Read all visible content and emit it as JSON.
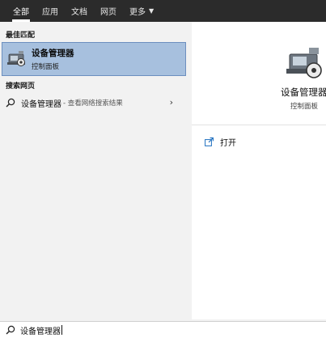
{
  "tabs": [
    {
      "label": "全部"
    },
    {
      "label": "应用"
    },
    {
      "label": "文档"
    },
    {
      "label": "网页"
    },
    {
      "label": "更多"
    }
  ],
  "sections": {
    "best_match": "最佳匹配",
    "web_search": "搜索网页"
  },
  "best_match": {
    "title": "设备管理器",
    "subtitle": "控制面板"
  },
  "web_result": {
    "term": "设备管理器",
    "desc": "- 查看网络搜索结果"
  },
  "preview": {
    "title": "设备管理器",
    "subtitle": "控制面板",
    "open_label": "打开"
  },
  "search": {
    "value": "设备管理器"
  },
  "icons": {
    "app": "device-manager-icon",
    "search": "search-icon",
    "chevron": "chevron-right-icon",
    "open": "open-window-icon"
  },
  "colors": {
    "topbar": "#2b2b2b",
    "selection": "#a7c0de",
    "selection_border": "#6c8fbf"
  }
}
